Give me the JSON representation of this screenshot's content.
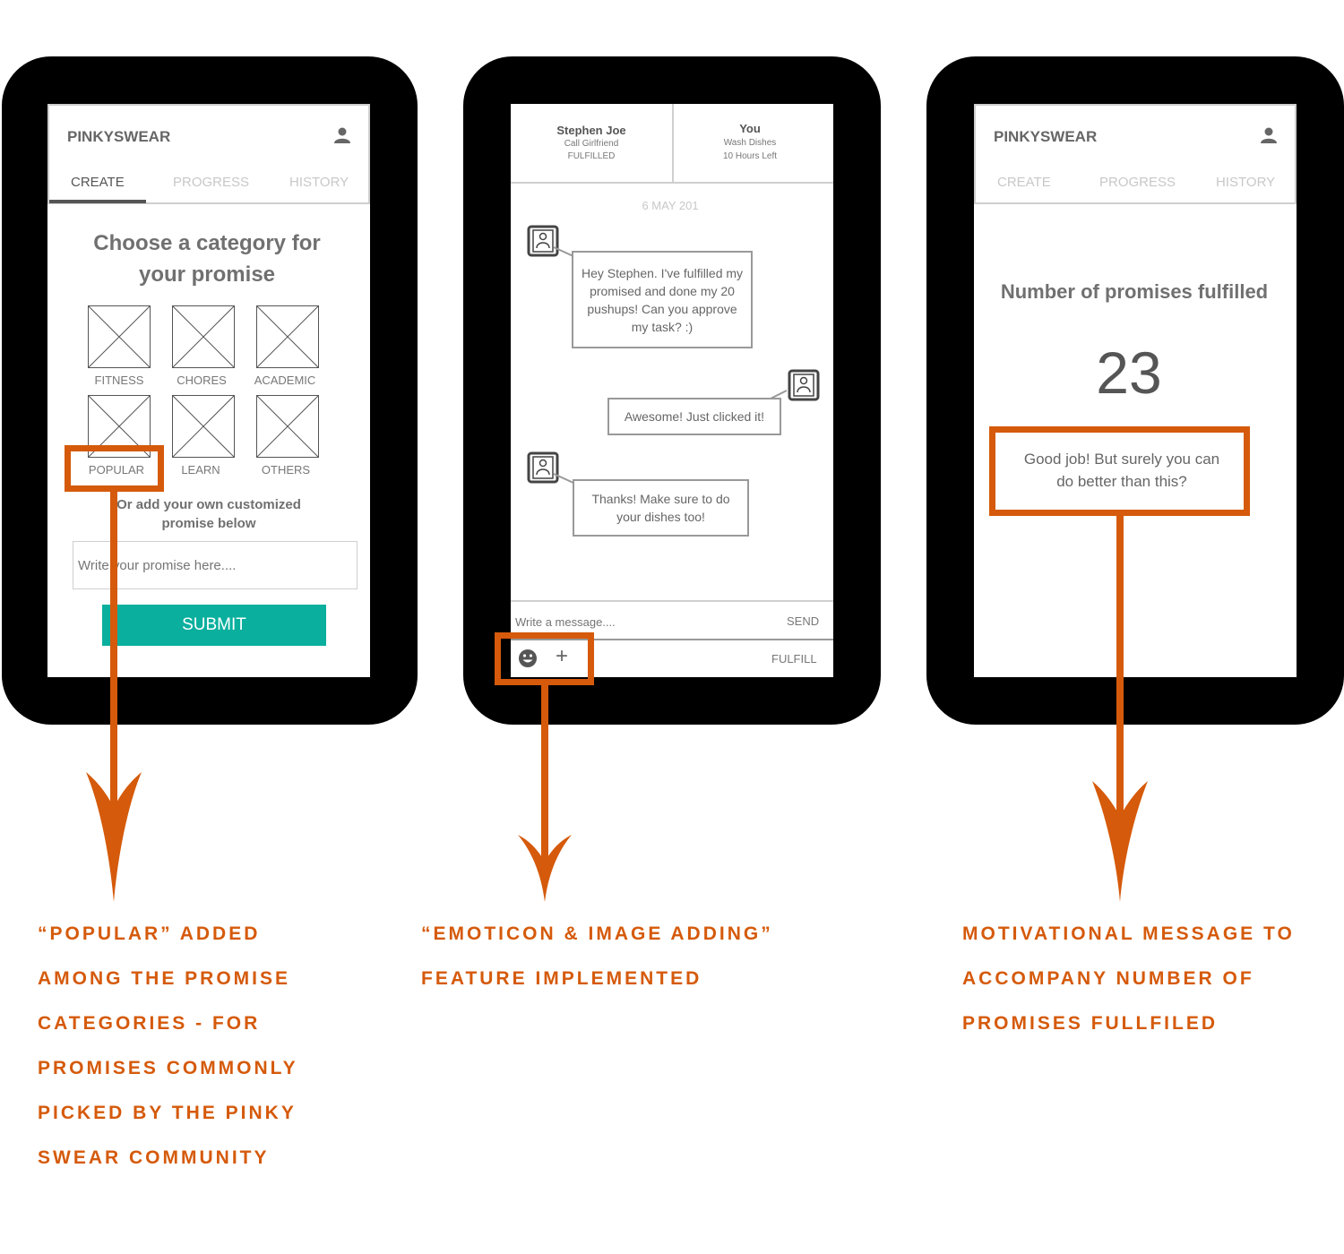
{
  "screen1": {
    "app_title": "PINKYSWEAR",
    "tabs": [
      "CREATE",
      "PROGRESS",
      "HISTORY"
    ],
    "heading_line1": "Choose a category for",
    "heading_line2": "your promise",
    "categories": [
      "FITNESS",
      "CHORES",
      "ACADEMIC",
      "POPULAR",
      "LEARN",
      "OTHERS"
    ],
    "custom_line1": "Or add your own customized",
    "custom_line2": "promise below",
    "input_placeholder": "Write your promise here....",
    "submit_label": "SUBMIT"
  },
  "screen2": {
    "left_header": {
      "name": "Stephen Joe",
      "task": "Call Girlfriend",
      "status": "FULFILLED"
    },
    "right_header": {
      "name": "You",
      "task": "Wash Dishes",
      "status": "10 Hours Left"
    },
    "date": "6 MAY 201",
    "messages": [
      "Hey Stephen. I've fulfilled my promised and done my 20 pushups! Can you approve my task? :)",
      "Awesome! Just clicked it!",
      "Thanks! Make sure to do your dishes too!"
    ],
    "message_placeholder": "Write a message....",
    "send_label": "SEND",
    "plus_symbol": "+",
    "fulfill_label": "FULFILL"
  },
  "screen3": {
    "app_title": "PINKYSWEAR",
    "tabs": [
      "CREATE",
      "PROGRESS",
      "HISTORY"
    ],
    "stat_label": "Number of promises fulfilled",
    "stat_value": "23",
    "motivation_line1": "Good job! But surely you can",
    "motivation_line2": "do better than this?"
  },
  "annotations": [
    "“POPULAR” ADDED\nAMONG THE PROMISE\nCATEGORIES - FOR\nPROMISES COMMONLY\nPICKED BY THE PINKY\nSWEAR COMMUNITY",
    "“EMOTICON & IMAGE ADDING”\nFEATURE IMPLEMENTED",
    "MOTIVATIONAL MESSAGE TO\nACCOMPANY NUMBER OF\nPROMISES FULLFILED"
  ],
  "colors": {
    "accent": "#d55a0b",
    "submit": "#0aaf9e",
    "frame": "#000000"
  }
}
